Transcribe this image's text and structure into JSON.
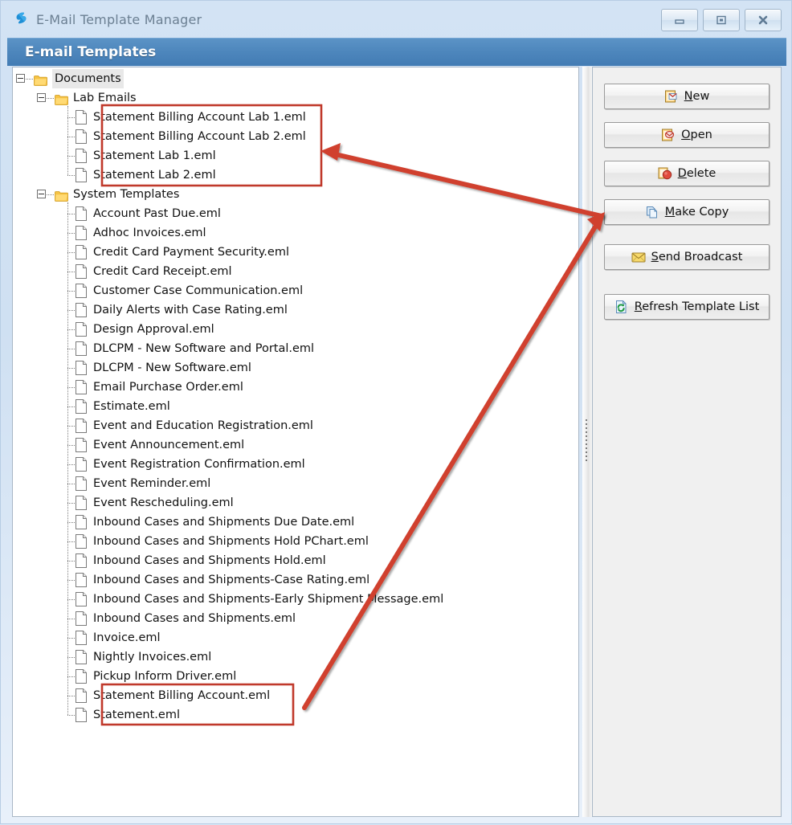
{
  "window": {
    "title": "E-Mail Template Manager",
    "logo_icon": "lightning-s-logo-icon",
    "controls": [
      {
        "name": "minimize",
        "icon": "minimize-icon"
      },
      {
        "name": "maximize",
        "icon": "maximize-icon"
      },
      {
        "name": "close",
        "icon": "close-icon"
      }
    ]
  },
  "header": {
    "title": "E-mail Templates"
  },
  "tree": {
    "root": {
      "label": "Documents",
      "icon": "folder-icon",
      "expanded": true,
      "selected": true
    },
    "groups": [
      {
        "label": "Lab Emails",
        "icon": "folder-icon",
        "expanded": true,
        "files": [
          "Statement Billing Account Lab 1.eml",
          "Statement Billing Account Lab 2.eml",
          "Statement Lab 1.eml",
          "Statement Lab 2.eml"
        ]
      },
      {
        "label": "System Templates",
        "icon": "folder-icon",
        "expanded": true,
        "files": [
          "Account Past Due.eml",
          "Adhoc Invoices.eml",
          "Credit Card Payment Security.eml",
          "Credit Card Receipt.eml",
          "Customer Case Communication.eml",
          "Daily Alerts with Case Rating.eml",
          "Design Approval.eml",
          "DLCPM - New Software and Portal.eml",
          "DLCPM - New Software.eml",
          "Email Purchase Order.eml",
          "Estimate.eml",
          "Event and Education Registration.eml",
          "Event Announcement.eml",
          "Event Registration Confirmation.eml",
          "Event Reminder.eml",
          "Event Rescheduling.eml",
          "Inbound Cases and Shipments Due Date.eml",
          "Inbound Cases and Shipments Hold PChart.eml",
          "Inbound Cases and Shipments Hold.eml",
          "Inbound Cases and Shipments-Case Rating.eml",
          "Inbound Cases and Shipments-Early Shipment Message.eml",
          "Inbound Cases and Shipments.eml",
          "Invoice.eml",
          "Nightly Invoices.eml",
          "Pickup Inform Driver.eml",
          "Statement Billing Account.eml",
          "Statement.eml"
        ]
      }
    ]
  },
  "buttons": [
    {
      "label_pre": "",
      "accel": "N",
      "label_post": "ew",
      "full": "New",
      "icon": "new-template-icon"
    },
    {
      "label_pre": "",
      "accel": "O",
      "label_post": "pen",
      "full": "Open",
      "icon": "open-template-icon"
    },
    {
      "label_pre": "",
      "accel": "D",
      "label_post": "elete",
      "full": "Delete",
      "icon": "delete-icon"
    },
    {
      "label_pre": "",
      "accel": "M",
      "label_post": "ake Copy",
      "full": "Make Copy",
      "icon": "copy-pages-icon"
    },
    {
      "label_pre": "",
      "accel": "S",
      "label_post": "end Broadcast",
      "full": "Send Broadcast",
      "icon": "envelope-icon"
    },
    {
      "label_pre": "",
      "accel": "R",
      "label_post": "efresh Template List",
      "full": "Refresh Template List",
      "icon": "refresh-icon"
    }
  ],
  "annotations": {
    "accent_color": "#c0392b",
    "highlight_boxes": [
      {
        "name": "lab-emails-highlight"
      },
      {
        "name": "statement-templates-highlight"
      }
    ],
    "arrows": [
      {
        "name": "arrow-make-copy-to-lab-emails"
      },
      {
        "name": "arrow-make-copy-to-statement-templates"
      }
    ]
  },
  "splitter": {
    "name": "panel-splitter",
    "icon": "grip-dots-icon"
  }
}
